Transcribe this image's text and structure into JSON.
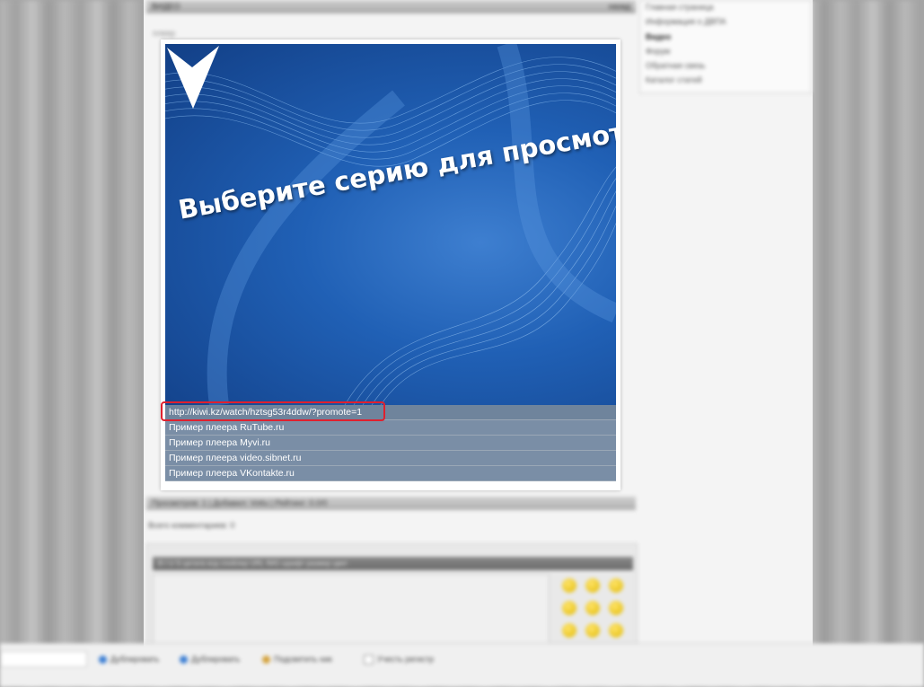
{
  "header": {
    "left_text": "ВИДЕО",
    "right_text": "назад"
  },
  "small_label": "плеер",
  "sidebar": {
    "items": [
      {
        "label": "Главная страница"
      },
      {
        "label": "Информация о ДВПА"
      },
      {
        "label": "Видео"
      },
      {
        "label": "Форум"
      },
      {
        "label": "Обратная связь"
      },
      {
        "label": "Каталог статей"
      }
    ]
  },
  "player": {
    "title": "Выберите серию для просмотра",
    "arrow_icon": "down-arrow-icon"
  },
  "series": [
    {
      "label": "http://kiwi.kz/watch/hztsg53r4ddw/?promote=1"
    },
    {
      "label": "Пример плеера RuTube.ru"
    },
    {
      "label": "Пример плеера Myvi.ru"
    },
    {
      "label": "Пример плеера video.sibnet.ru"
    },
    {
      "label": "Пример плеера VKontakte.ru"
    }
  ],
  "infobar": {
    "text": "Просмотров: 1 | Добавил: Vottu | Рейтинг: 0.0/0"
  },
  "comments": {
    "count_text": "Всего комментариев: 0"
  },
  "editor": {
    "toolbar_text": "B   I   U   S   цитата   код   спойлер   URL   IMG   шрифт   размер   цвет"
  },
  "bottombar": {
    "options": [
      {
        "label": "Дублировать"
      },
      {
        "label": "Дублировать"
      },
      {
        "label": "Подсветить ник"
      },
      {
        "label": "Учесть регистр"
      }
    ]
  },
  "colors": {
    "highlight_box": "#e0202e",
    "series_row": "#7a8ea6",
    "video_bg": "#2060b5"
  }
}
